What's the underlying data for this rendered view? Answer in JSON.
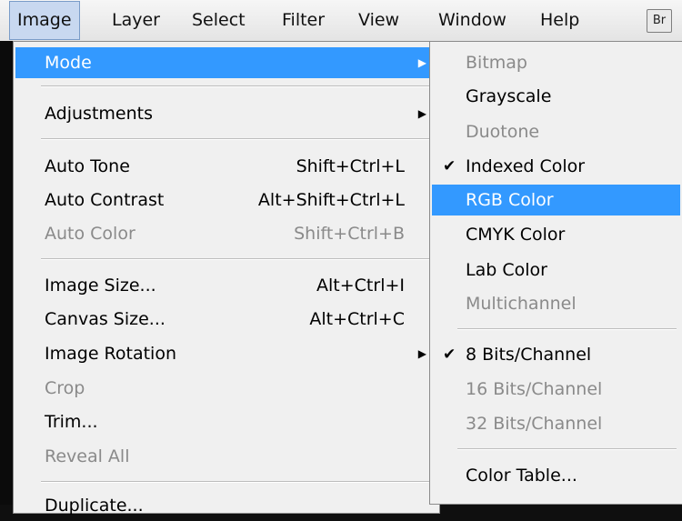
{
  "menubar": {
    "items": [
      "Image",
      "Layer",
      "Select",
      "Filter",
      "View",
      "Window",
      "Help"
    ],
    "badge": "Br"
  },
  "image_menu": {
    "items": [
      {
        "label": "Mode",
        "shortcut": "",
        "submenu": true,
        "state": "highlight"
      },
      {
        "label": "Adjustments",
        "shortcut": "",
        "submenu": true,
        "state": "normal"
      },
      {
        "label": "Auto Tone",
        "shortcut": "Shift+Ctrl+L",
        "submenu": false,
        "state": "normal"
      },
      {
        "label": "Auto Contrast",
        "shortcut": "Alt+Shift+Ctrl+L",
        "submenu": false,
        "state": "normal"
      },
      {
        "label": "Auto Color",
        "shortcut": "Shift+Ctrl+B",
        "submenu": false,
        "state": "disabled"
      },
      {
        "label": "Image Size...",
        "shortcut": "Alt+Ctrl+I",
        "submenu": false,
        "state": "normal"
      },
      {
        "label": "Canvas Size...",
        "shortcut": "Alt+Ctrl+C",
        "submenu": false,
        "state": "normal"
      },
      {
        "label": "Image Rotation",
        "shortcut": "",
        "submenu": true,
        "state": "normal"
      },
      {
        "label": "Crop",
        "shortcut": "",
        "submenu": false,
        "state": "disabled"
      },
      {
        "label": "Trim...",
        "shortcut": "",
        "submenu": false,
        "state": "normal"
      },
      {
        "label": "Reveal All",
        "shortcut": "",
        "submenu": false,
        "state": "disabled"
      },
      {
        "label": "Duplicate...",
        "shortcut": "",
        "submenu": false,
        "state": "normal"
      }
    ]
  },
  "mode_submenu": {
    "items": [
      {
        "label": "Bitmap",
        "checked": false,
        "state": "disabled"
      },
      {
        "label": "Grayscale",
        "checked": false,
        "state": "normal"
      },
      {
        "label": "Duotone",
        "checked": false,
        "state": "disabled"
      },
      {
        "label": "Indexed Color",
        "checked": true,
        "state": "normal"
      },
      {
        "label": "RGB Color",
        "checked": false,
        "state": "highlight"
      },
      {
        "label": "CMYK Color",
        "checked": false,
        "state": "normal"
      },
      {
        "label": "Lab Color",
        "checked": false,
        "state": "normal"
      },
      {
        "label": "Multichannel",
        "checked": false,
        "state": "disabled"
      },
      {
        "label": "8 Bits/Channel",
        "checked": true,
        "state": "normal"
      },
      {
        "label": "16 Bits/Channel",
        "checked": false,
        "state": "disabled"
      },
      {
        "label": "32 Bits/Channel",
        "checked": false,
        "state": "disabled"
      },
      {
        "label": "Color Table...",
        "checked": false,
        "state": "normal"
      }
    ]
  },
  "colors": {
    "highlight": "#3399ff",
    "menu_bg": "#f0f0f0",
    "disabled_text": "#8a8a8a"
  }
}
